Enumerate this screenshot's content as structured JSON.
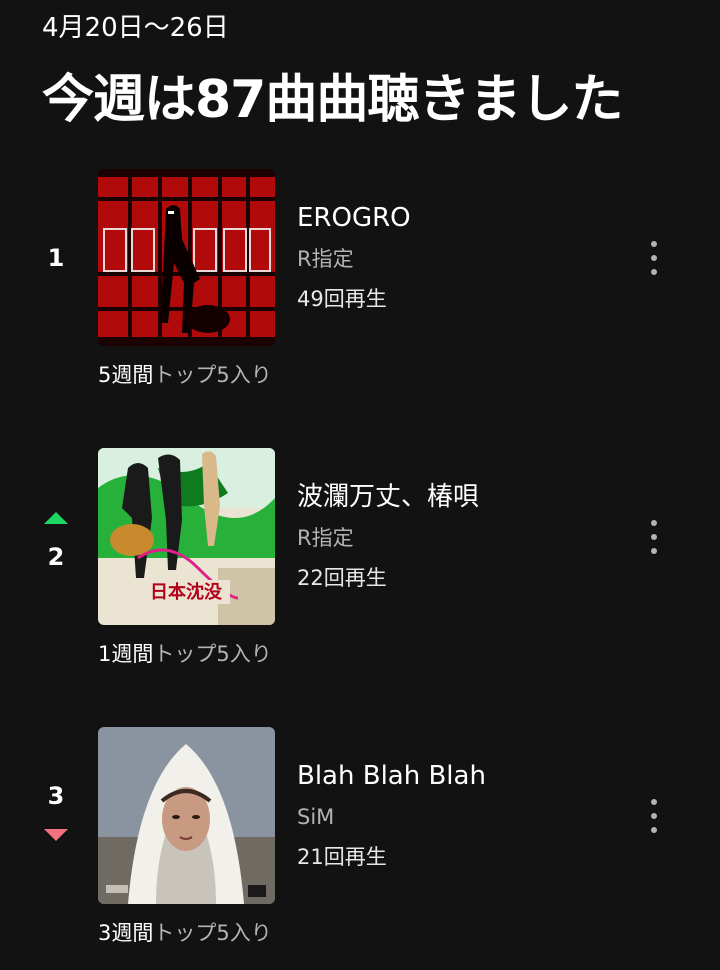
{
  "header": {
    "date_range": "4月20日〜26日",
    "title": "今週は87曲曲聴きました"
  },
  "colors": {
    "background": "#121212",
    "trend_up": "#1ed760",
    "trend_down": "#f3727f",
    "secondary_text": "#b3b3b3"
  },
  "tracks": [
    {
      "rank": "1",
      "trend": "none",
      "cover_icon": "album-cover-erogro",
      "title": "EROGRO",
      "artist": "R指定",
      "plays": "49回再生",
      "weeks_count": "5週間",
      "weeks_suffix": "トップ5入り"
    },
    {
      "rank": "2",
      "trend": "up",
      "cover_icon": "album-cover-nihon-chinbotsu",
      "cover_text": "日本沈没",
      "title": "波瀾万丈、椿唄",
      "artist": "R指定",
      "plays": "22回再生",
      "weeks_count": "1週間",
      "weeks_suffix": "トップ5入り"
    },
    {
      "rank": "3",
      "trend": "down",
      "cover_icon": "album-cover-blah-blah-blah",
      "title": "Blah Blah Blah",
      "artist": "SiM",
      "plays": "21回再生",
      "weeks_count": "3週間",
      "weeks_suffix": "トップ5入り"
    }
  ]
}
